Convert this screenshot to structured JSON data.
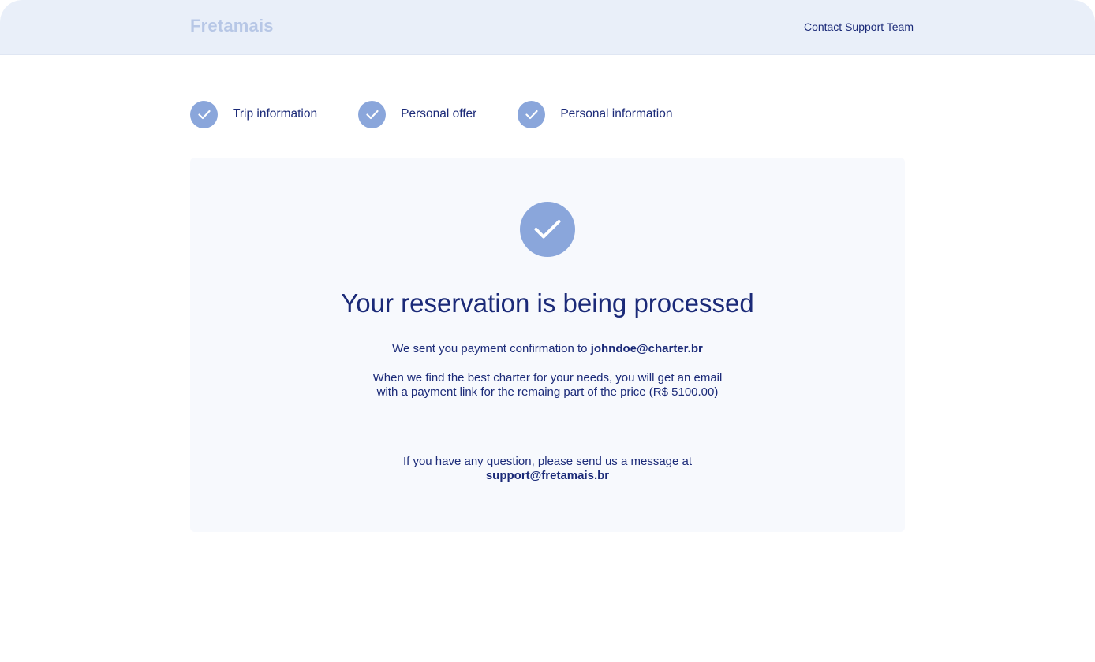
{
  "header": {
    "logo": "Fretamais",
    "contact_link": "Contact Support Team"
  },
  "steps": [
    {
      "label": "Trip information",
      "icon": "check-icon",
      "status": "completed"
    },
    {
      "label": "Personal offer",
      "icon": "check-icon",
      "status": "completed"
    },
    {
      "label": "Personal information",
      "icon": "check-icon",
      "status": "completed"
    }
  ],
  "confirmation": {
    "icon": "check-icon",
    "title": "Your reservation is being processed",
    "sent_text": "We sent you payment confirmation to",
    "email": "johndoe@charter.br",
    "charter_line1": "When we find the best charter for your needs, you will get an email",
    "charter_line2": "with a payment link for the remaing part of the price (R$ 5100.00)",
    "question_text": "If you have any question, please send us a message at",
    "support_email": "support@fretamais.br"
  },
  "colors": {
    "header_bg": "#e9eff9",
    "accent": "#8aa6db",
    "text": "#1b2a78",
    "logo": "#b7c7e6",
    "card_bg": "#f7f9fd"
  }
}
